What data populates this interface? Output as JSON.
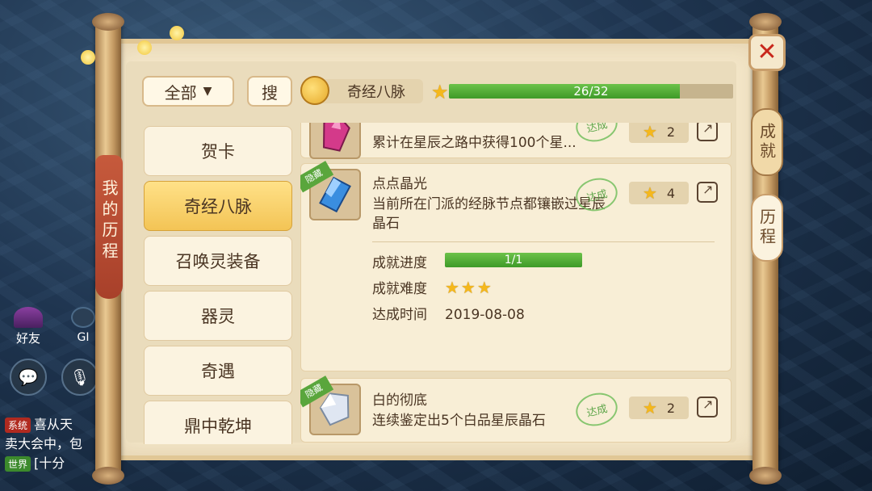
{
  "window": {
    "title": "我的历程"
  },
  "side_tabs": {
    "left": "我的历程",
    "right": [
      {
        "label": "成就",
        "active": true
      },
      {
        "label": "历程",
        "active": false
      }
    ]
  },
  "toolbar": {
    "filter_label": "全部",
    "search_label": "搜",
    "category_label": "奇经八脉",
    "progress_text": "26/32",
    "progress_value": 0.8125
  },
  "categories": [
    {
      "label": "贺卡",
      "active": false
    },
    {
      "label": "奇经八脉",
      "active": true
    },
    {
      "label": "召唤灵装备",
      "active": false
    },
    {
      "label": "器灵",
      "active": false
    },
    {
      "label": "奇遇",
      "active": false
    },
    {
      "label": "鼎中乾坤",
      "active": false
    }
  ],
  "entries": [
    {
      "title": "",
      "desc": "累计在星辰之路中获得100个星...",
      "stamp": "达成",
      "points": "2",
      "gem_color": "#d43a8a",
      "hidden": false
    },
    {
      "title": "点点晶光",
      "desc": "当前所在门派的经脉节点都镶嵌过星辰晶石",
      "stamp": "达成",
      "points": "4",
      "gem_color": "#3a8ee0",
      "hidden": true,
      "detail": {
        "progress_label": "成就进度",
        "progress_text": "1/1",
        "progress_value": 1.0,
        "difficulty_label": "成就难度",
        "difficulty_stars": "★★★",
        "time_label": "达成时间",
        "time_value": "2019-08-08"
      }
    },
    {
      "title": "白的彻底",
      "desc": "连续鉴定出5个白品星辰晶石",
      "stamp": "达成",
      "points": "2",
      "gem_color": "#dfe6f2",
      "hidden": true
    }
  ],
  "hud": {
    "friend_label": "好友",
    "gm_label": "GI",
    "chat_icon": "chat-bubble-icon",
    "voice_icon": "microphone-icon",
    "chat_lines": [
      {
        "tag": "系统",
        "text": "喜从天"
      },
      {
        "tag": "",
        "text": "卖大会中，包"
      },
      {
        "tag": "世界",
        "text": "[十分"
      }
    ]
  },
  "colors": {
    "accent_green": "#4ea832",
    "star_gold": "#f5b81c",
    "close_red": "#c8271c",
    "tab_red": "#b64a30"
  }
}
